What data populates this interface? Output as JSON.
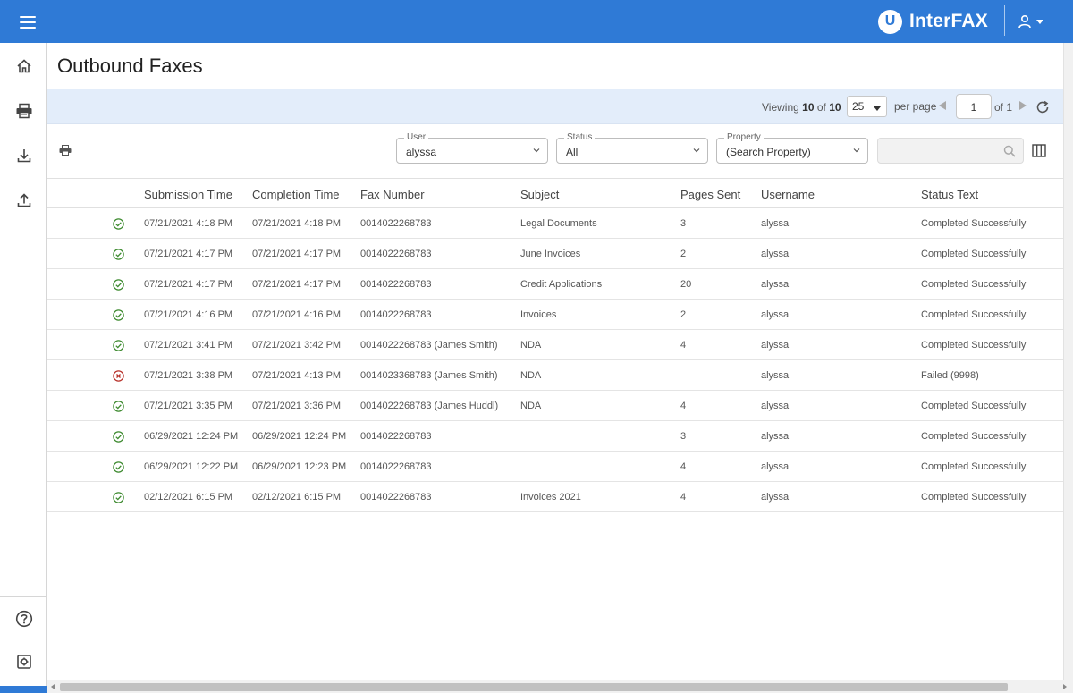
{
  "header": {
    "brand_logo_letter": "U",
    "brand_name": "InterFAX",
    "accent_color": "#2f7ad6",
    "icons": [
      "hamburger-menu-icon",
      "user-icon",
      "chevron-down-icon"
    ]
  },
  "sidebar": {
    "items": [
      {
        "icon": "home-icon"
      },
      {
        "icon": "printer-icon"
      },
      {
        "icon": "download-icon"
      },
      {
        "icon": "upload-icon"
      }
    ],
    "bottom_items": [
      {
        "icon": "help-icon"
      },
      {
        "icon": "settings-icon"
      }
    ]
  },
  "page": {
    "title": "Outbound Faxes"
  },
  "pagination": {
    "viewing_prefix": "Viewing",
    "viewing_count": "10",
    "viewing_of": "of",
    "viewing_total": "10",
    "per_page_value": "25",
    "per_page_label": "per page",
    "current_page": "1",
    "of_pages": "of 1"
  },
  "filters": {
    "user": {
      "label": "User",
      "value": "alyssa"
    },
    "status": {
      "label": "Status",
      "value": "All"
    },
    "property": {
      "label": "Property",
      "value": "(Search Property)"
    },
    "search": {
      "placeholder": ""
    }
  },
  "table": {
    "columns": [
      "Submission Time",
      "Completion Time",
      "Fax Number",
      "Subject",
      "Pages Sent",
      "Username",
      "Status Text"
    ],
    "rows": [
      {
        "status": "success",
        "submission": "07/21/2021 4:18 PM",
        "completion": "07/21/2021 4:18 PM",
        "fax": "0014022268783",
        "subject": "Legal Documents",
        "pages": "3",
        "username": "alyssa",
        "status_text": "Completed Successfully"
      },
      {
        "status": "success",
        "submission": "07/21/2021 4:17 PM",
        "completion": "07/21/2021 4:17 PM",
        "fax": "0014022268783",
        "subject": "June Invoices",
        "pages": "2",
        "username": "alyssa",
        "status_text": "Completed Successfully"
      },
      {
        "status": "success",
        "submission": "07/21/2021 4:17 PM",
        "completion": "07/21/2021 4:17 PM",
        "fax": "0014022268783",
        "subject": "Credit Applications",
        "pages": "20",
        "username": "alyssa",
        "status_text": "Completed Successfully"
      },
      {
        "status": "success",
        "submission": "07/21/2021 4:16 PM",
        "completion": "07/21/2021 4:16 PM",
        "fax": "0014022268783",
        "subject": "Invoices",
        "pages": "2",
        "username": "alyssa",
        "status_text": "Completed Successfully"
      },
      {
        "status": "success",
        "submission": "07/21/2021 3:41 PM",
        "completion": "07/21/2021 3:42 PM",
        "fax": "0014022268783 (James Smith)",
        "subject": "NDA",
        "pages": "4",
        "username": "alyssa",
        "status_text": "Completed Successfully"
      },
      {
        "status": "failed",
        "submission": "07/21/2021 3:38 PM",
        "completion": "07/21/2021 4:13 PM",
        "fax": "0014023368783 (James Smith)",
        "subject": "NDA",
        "pages": "",
        "username": "alyssa",
        "status_text": "Failed (9998)"
      },
      {
        "status": "success",
        "submission": "07/21/2021 3:35 PM",
        "completion": "07/21/2021 3:36 PM",
        "fax": "0014022268783 (James Huddl)",
        "subject": "NDA",
        "pages": "4",
        "username": "alyssa",
        "status_text": "Completed Successfully"
      },
      {
        "status": "success",
        "submission": "06/29/2021 12:24 PM",
        "completion": "06/29/2021 12:24 PM",
        "fax": "0014022268783",
        "subject": "",
        "pages": "3",
        "username": "alyssa",
        "status_text": "Completed Successfully"
      },
      {
        "status": "success",
        "submission": "06/29/2021 12:22 PM",
        "completion": "06/29/2021 12:23 PM",
        "fax": "0014022268783",
        "subject": "",
        "pages": "4",
        "username": "alyssa",
        "status_text": "Completed Successfully"
      },
      {
        "status": "success",
        "submission": "02/12/2021 6:15 PM",
        "completion": "02/12/2021 6:15 PM",
        "fax": "0014022268783",
        "subject": "Invoices 2021",
        "pages": "4",
        "username": "alyssa",
        "status_text": "Completed Successfully"
      }
    ]
  },
  "colors": {
    "success_icon": "#3d8a2f",
    "failed_icon": "#b8322b",
    "pager_band": "#e3edfa"
  }
}
